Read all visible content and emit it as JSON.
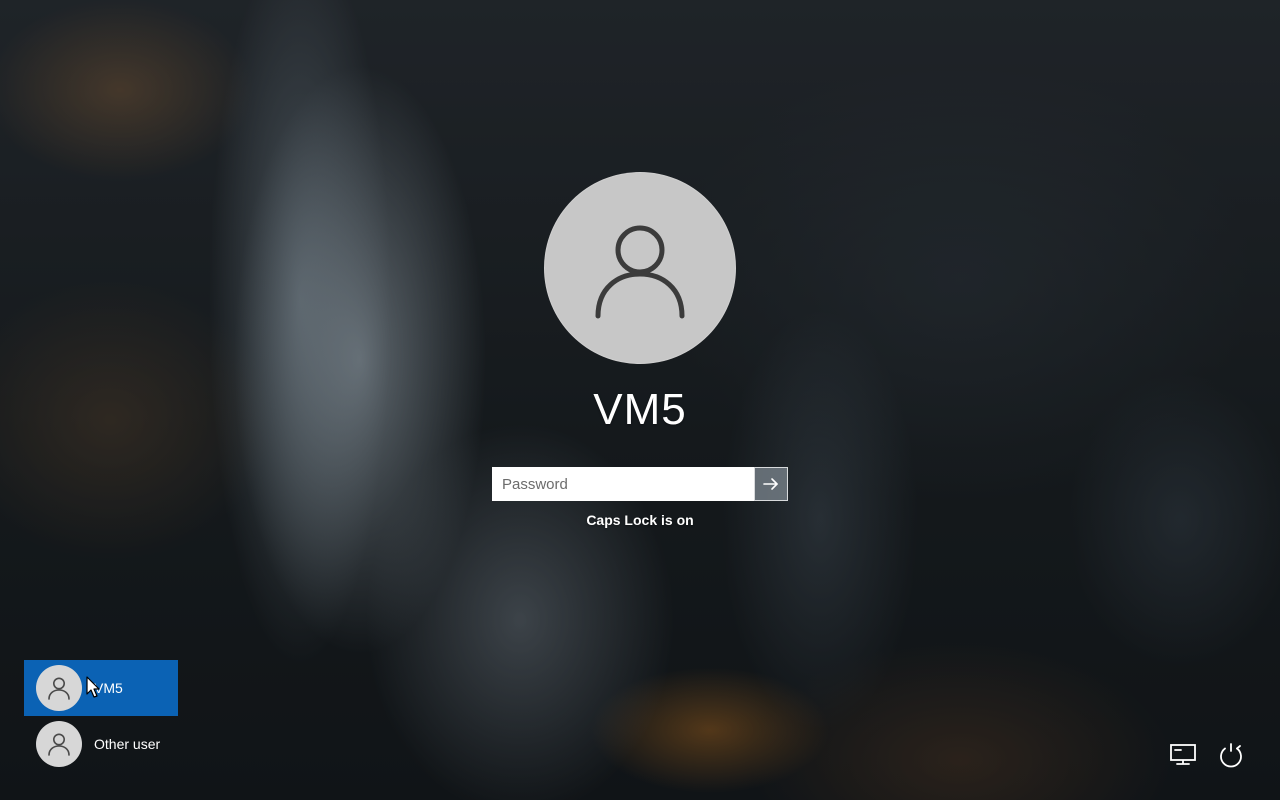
{
  "lock_screen": {
    "username": "VM5",
    "password_placeholder": "Password",
    "password_value": "",
    "caps_lock_message": "Caps Lock is on"
  },
  "user_switcher": {
    "users": [
      {
        "label": "VM5",
        "selected": true
      },
      {
        "label": "Other user",
        "selected": false
      }
    ]
  },
  "icons": {
    "avatar": "user-silhouette",
    "submit": "arrow-right",
    "network": "network-monitor",
    "power": "power-restart"
  },
  "colors": {
    "selected_tile": "#0b62b4",
    "avatar_bg": "#c7c7c7",
    "text": "#ffffff"
  }
}
